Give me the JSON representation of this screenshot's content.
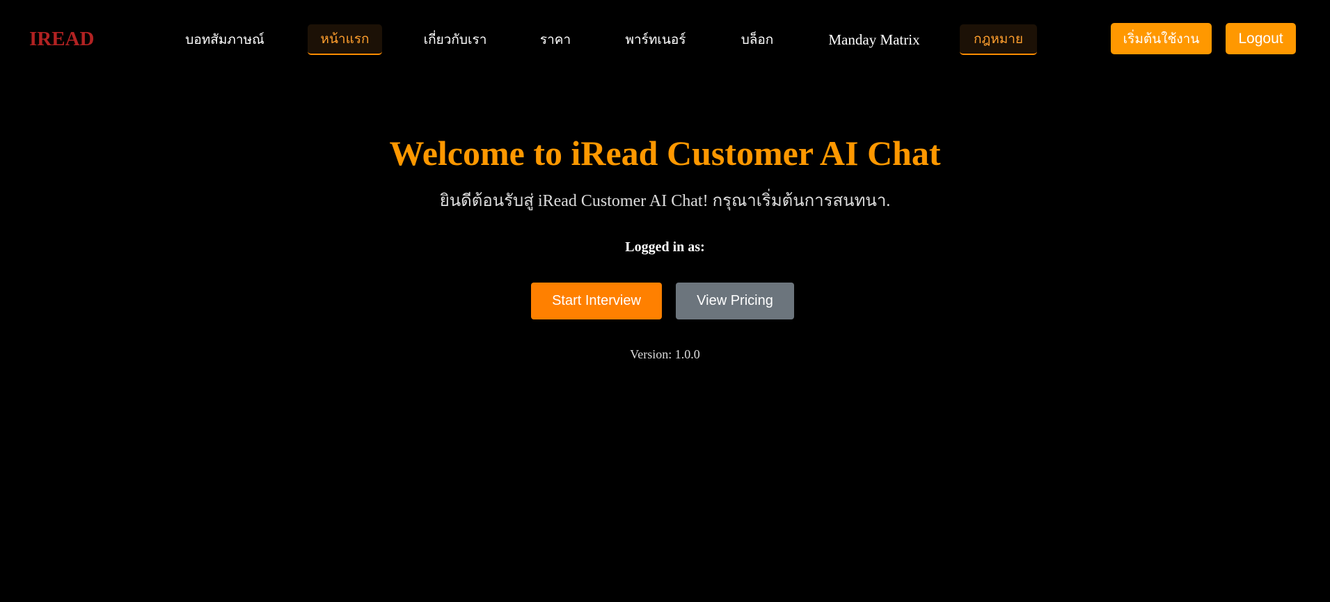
{
  "header": {
    "logo": "IREAD",
    "nav": [
      {
        "label": "บอทสัมภาษณ์",
        "active": false
      },
      {
        "label": "หน้าแรก",
        "active": true
      },
      {
        "label": "เกี่ยวกับเรา",
        "active": false
      },
      {
        "label": "ราคา",
        "active": false
      },
      {
        "label": "พาร์ทเนอร์",
        "active": false
      },
      {
        "label": "บล็อก",
        "active": false
      },
      {
        "label": "Manday Matrix",
        "active": false
      },
      {
        "label": "กฎหมาย",
        "active": true
      }
    ],
    "get_started_label": "เริ่มต้นใช้งาน",
    "logout_label": "Logout"
  },
  "main": {
    "title": "Welcome to iRead Customer AI Chat",
    "subtitle": "ยินดีต้อนรับสู่ iRead Customer AI Chat! กรุณาเริ่มต้นการสนทนา.",
    "logged_in_label": "Logged in as:",
    "start_interview_label": "Start Interview",
    "view_pricing_label": "View Pricing",
    "version_text": "Version: 1.0.0"
  },
  "colors": {
    "background": "#000000",
    "accent": "#ff9800",
    "logo": "#b22222",
    "secondary_button": "#6c757d"
  }
}
